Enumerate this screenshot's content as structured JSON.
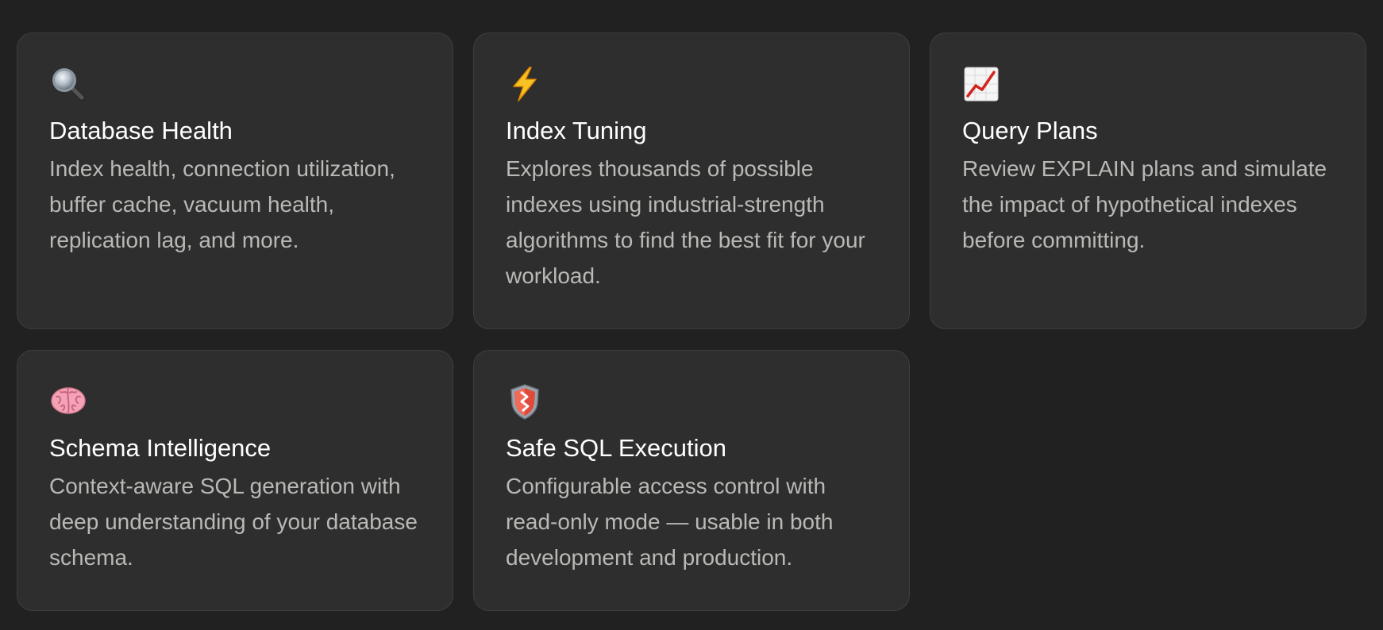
{
  "features": [
    {
      "icon": "magnifying-glass-icon",
      "title": "Database Health",
      "description": "Index health, connection utilization, buffer cache, vacuum health, replication lag, and more."
    },
    {
      "icon": "lightning-bolt-icon",
      "title": "Index Tuning",
      "description": "Explores thousands of possible indexes using industrial-strength algorithms to find the best fit for your workload."
    },
    {
      "icon": "chart-increasing-icon",
      "title": "Query Plans",
      "description": "Review EXPLAIN plans and simulate the impact of hypothetical indexes before committing."
    },
    {
      "icon": "brain-icon",
      "title": "Schema Intelligence",
      "description": "Context-aware SQL generation with deep understanding of your database schema."
    },
    {
      "icon": "shield-icon",
      "title": "Safe SQL Execution",
      "description": "Configurable access control with read-only mode — usable in both development and production."
    }
  ],
  "colors": {
    "background": "#212121",
    "card": "#2e2e2e",
    "card_border": "#3e3e3e",
    "title": "#ffffff",
    "description": "#b9b9b6"
  }
}
